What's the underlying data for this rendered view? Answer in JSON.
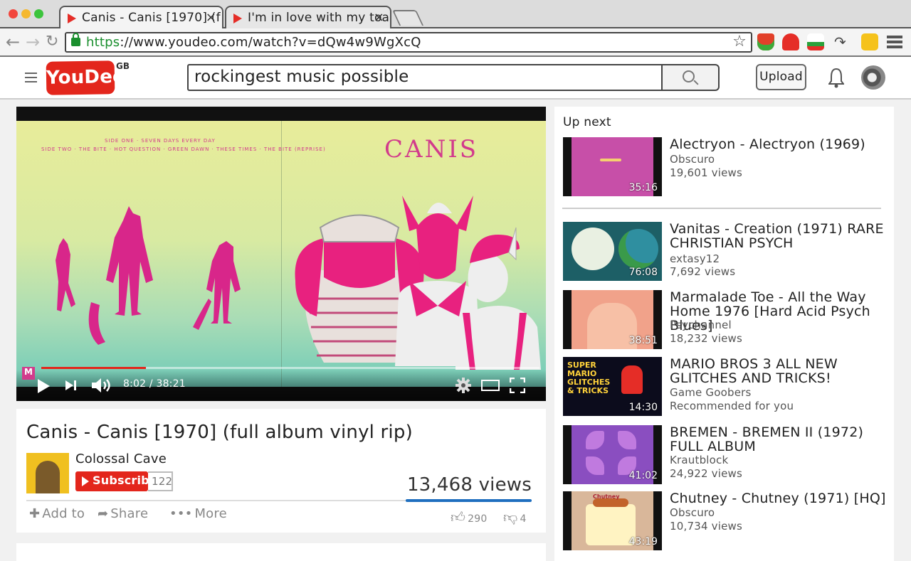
{
  "browser": {
    "tabs": [
      {
        "title": "Canis - Canis [1970] (f",
        "active": true
      },
      {
        "title": "I'm in love with my toas",
        "active": false
      }
    ],
    "url_scheme": "https",
    "url_rest": "://www.youdeo.com/watch?v=dQw4w9WgXcQ"
  },
  "site": {
    "logo": "YouDeo",
    "region": "GB",
    "search_value": "rockingest music possible",
    "upload_label": "Upload",
    "brand_color": "#e3261c"
  },
  "player": {
    "cover_title": "CANIS",
    "cover_side_one": "SIDE ONE · SEVEN DAYS EVERY DAY",
    "cover_side_two": "SIDE TWO · THE BITE · HOT QUESTION · GREEN DAWN · THESE TIMES · THE BITE (REPRISE)",
    "time": "8:02 / 38:21",
    "progress": 0.21,
    "badge": "M"
  },
  "video": {
    "title": "Canis - Canis [1970] (full album vinyl rip)",
    "channel": "Colossal Cave",
    "subscribe_label": "Subscribe",
    "subscriber_count": "122",
    "views": "13,468 views",
    "actions": {
      "add_to": "Add to",
      "share": "Share",
      "more": "More"
    },
    "likes": "290",
    "dislikes": "4",
    "like_ratio": 0.986
  },
  "sidebar": {
    "heading": "Up next",
    "items": [
      {
        "title": "Alectryon - Alectryon (1969)",
        "channel": "Obscuro",
        "meta": "19,601 views",
        "duration": "35:16"
      },
      {
        "title": "Vanitas - Creation (1971) RARE CHRISTIAN PSYCH",
        "channel": "extasy12",
        "meta": "7,692 views",
        "duration": "76:08"
      },
      {
        "title": "Marmalade Toe - All the Way Home 1976 [Hard Acid Psych Blues]",
        "channel": "Psychannel",
        "meta": "18,232 views",
        "duration": "38:51"
      },
      {
        "title": "MARIO BROS 3 ALL NEW GLITCHES AND TRICKS!",
        "channel": "Game Goobers",
        "meta": "Recommended for you",
        "duration": "14:30",
        "thumb_text": "SUPER MARIO GLITCHES & TRICKS"
      },
      {
        "title": "BREMEN - BREMEN II (1972) FULL ALBUM",
        "channel": "Krautblock",
        "meta": "24,922 views",
        "duration": "41:02"
      },
      {
        "title": "Chutney - Chutney (1971) [HQ]",
        "channel": "Obscuro",
        "meta": "10,734 views",
        "duration": "43:19",
        "thumb_text": "Chutney"
      }
    ]
  }
}
